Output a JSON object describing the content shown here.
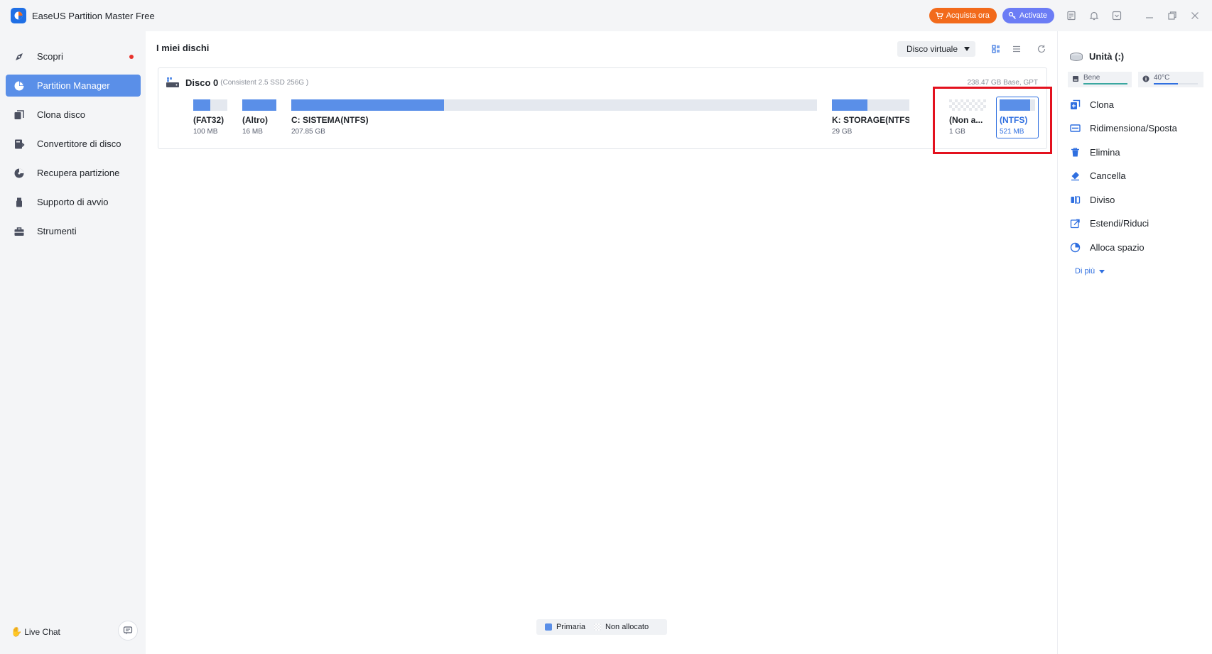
{
  "app": {
    "title": "EaseUS Partition Master Free",
    "buy_label": "Acquista ora",
    "activate_label": "Activate"
  },
  "sidebar": {
    "items": [
      {
        "label": "Scopri",
        "icon": "compass-icon"
      },
      {
        "label": "Partition Manager",
        "icon": "pie-chart-icon"
      },
      {
        "label": "Clona disco",
        "icon": "clone-disk-icon"
      },
      {
        "label": "Convertitore di disco",
        "icon": "convert-icon"
      },
      {
        "label": "Recupera partizione",
        "icon": "recover-icon"
      },
      {
        "label": "Supporto di avvio",
        "icon": "usb-icon"
      },
      {
        "label": "Strumenti",
        "icon": "toolbox-icon"
      }
    ],
    "live_chat": "Live Chat"
  },
  "main": {
    "title": "I miei dischi",
    "virtual_disk_label": "Disco virtuale",
    "disk": {
      "name": "Disco 0",
      "subtitle": "(Consistent 2.5 SSD 256G )",
      "info": "238.47 GB Base, GPT",
      "partitions": [
        {
          "name": "(FAT32)",
          "size": "100 MB",
          "used_fraction": 0.5
        },
        {
          "name": "(Altro)",
          "size": "16 MB",
          "used_fraction": 1.0
        },
        {
          "name": "C: SISTEMA(NTFS)",
          "size": "207.85 GB",
          "used_fraction": 0.29
        },
        {
          "name": "K: STORAGE(NTFS)",
          "size": "29 GB",
          "used_fraction": 0.46
        },
        {
          "name": "(Non a...",
          "size": "1 GB",
          "used_fraction": 0
        },
        {
          "name": "(NTFS)",
          "size": "521 MB",
          "used_fraction": 0.85
        }
      ]
    },
    "legend": {
      "primary": "Primaria",
      "unallocated": "Non allocato"
    }
  },
  "right_panel": {
    "unit_title": "Unità (:)",
    "health_label": "Bene",
    "temperature": "40°C",
    "actions": [
      {
        "label": "Clona",
        "icon": "clone-icon"
      },
      {
        "label": "Ridimensiona/Sposta",
        "icon": "resize-icon"
      },
      {
        "label": "Elimina",
        "icon": "trash-icon"
      },
      {
        "label": "Cancella",
        "icon": "eraser-icon"
      },
      {
        "label": "Diviso",
        "icon": "split-icon"
      },
      {
        "label": "Estendi/Riduci",
        "icon": "extend-icon"
      },
      {
        "label": "Alloca spazio",
        "icon": "allocate-icon"
      }
    ],
    "more_label": "Di più"
  },
  "colors": {
    "accent": "#2f6fe0",
    "primary_partition": "#5a8fe8",
    "buy": "#f26a1b",
    "activate": "#6b7cf5",
    "highlight": "#e3111e"
  }
}
